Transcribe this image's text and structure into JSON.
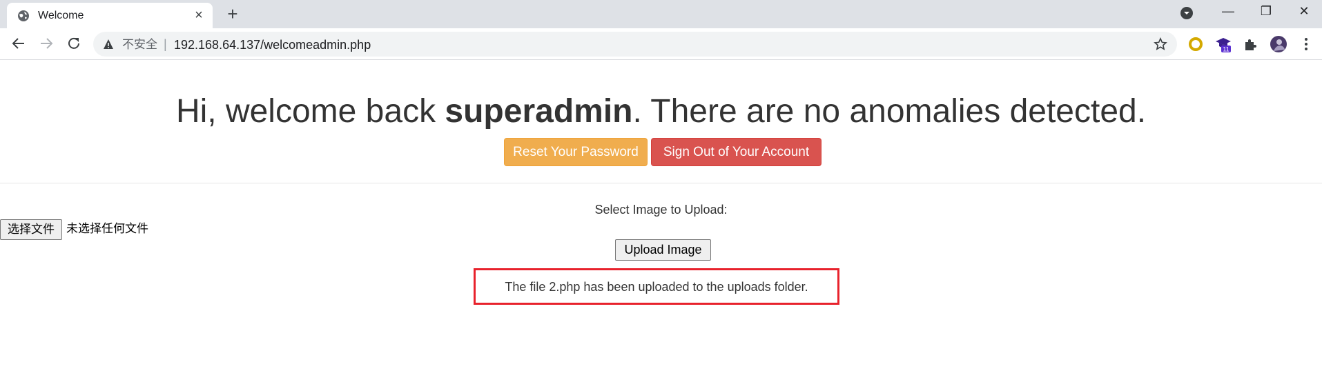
{
  "browser": {
    "tab": {
      "title": "Welcome"
    },
    "new_tab_symbol": "+",
    "window_controls": {
      "minimize": "—",
      "maximize": "❐",
      "close": "✕"
    },
    "omnibox": {
      "security_label": "不安全",
      "separator": "|",
      "url": "192.168.64.137/welcomeadmin.php"
    },
    "extensions": [
      {
        "icon": "ring-extension-icon",
        "badge": ""
      },
      {
        "icon": "graduation-cap-extension-icon",
        "badge": "11"
      },
      {
        "icon": "puzzle-extensions-icon",
        "badge": ""
      },
      {
        "icon": "profile-avatar-icon",
        "badge": ""
      }
    ]
  },
  "page": {
    "greeting_prefix": "Hi, welcome back ",
    "username": "superadmin",
    "greeting_suffix": ". There are no anomalies detected.",
    "reset_password_label": "Reset Your Password",
    "sign_out_label": "Sign Out of Your Account",
    "upload": {
      "select_label": "Select Image to Upload:",
      "file_button_label": "选择文件",
      "file_status": "未选择任何文件",
      "upload_button_label": "Upload Image",
      "result_message": "The file 2.php has been uploaded to the uploads folder."
    }
  },
  "colors": {
    "reset_button": "#f0ad4e",
    "sign_out_button": "#d9534f",
    "highlight_border": "#e8222c",
    "tabstrip": "#dee1e6"
  }
}
